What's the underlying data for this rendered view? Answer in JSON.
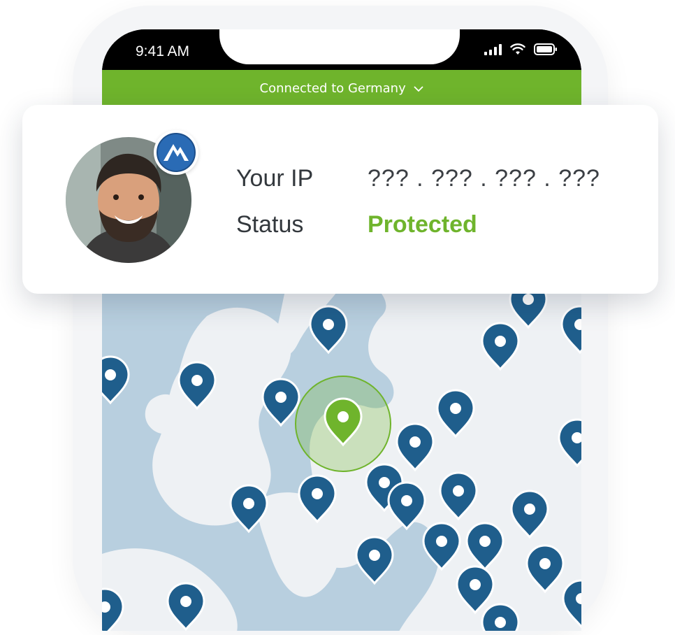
{
  "status_bar": {
    "time": "9:41 AM",
    "icons": [
      "signal-icon",
      "wifi-icon",
      "battery-icon"
    ]
  },
  "connection_banner": {
    "text": "Connected to Germany",
    "chevron": "chevron-down-icon",
    "color": "#6fb42c"
  },
  "info_card": {
    "ip_label": "Your IP",
    "ip_value": "??? . ??? . ??? . ???",
    "status_label": "Status",
    "status_value": "Protected",
    "status_color": "#6fb42c",
    "badge_icon": "mountain-logo-icon"
  },
  "map": {
    "land_color": "#f2f4f6",
    "water_color": "#b8cfdf",
    "pin_color": "#1f5e8c",
    "active_pin_color": "#6fb42c"
  }
}
